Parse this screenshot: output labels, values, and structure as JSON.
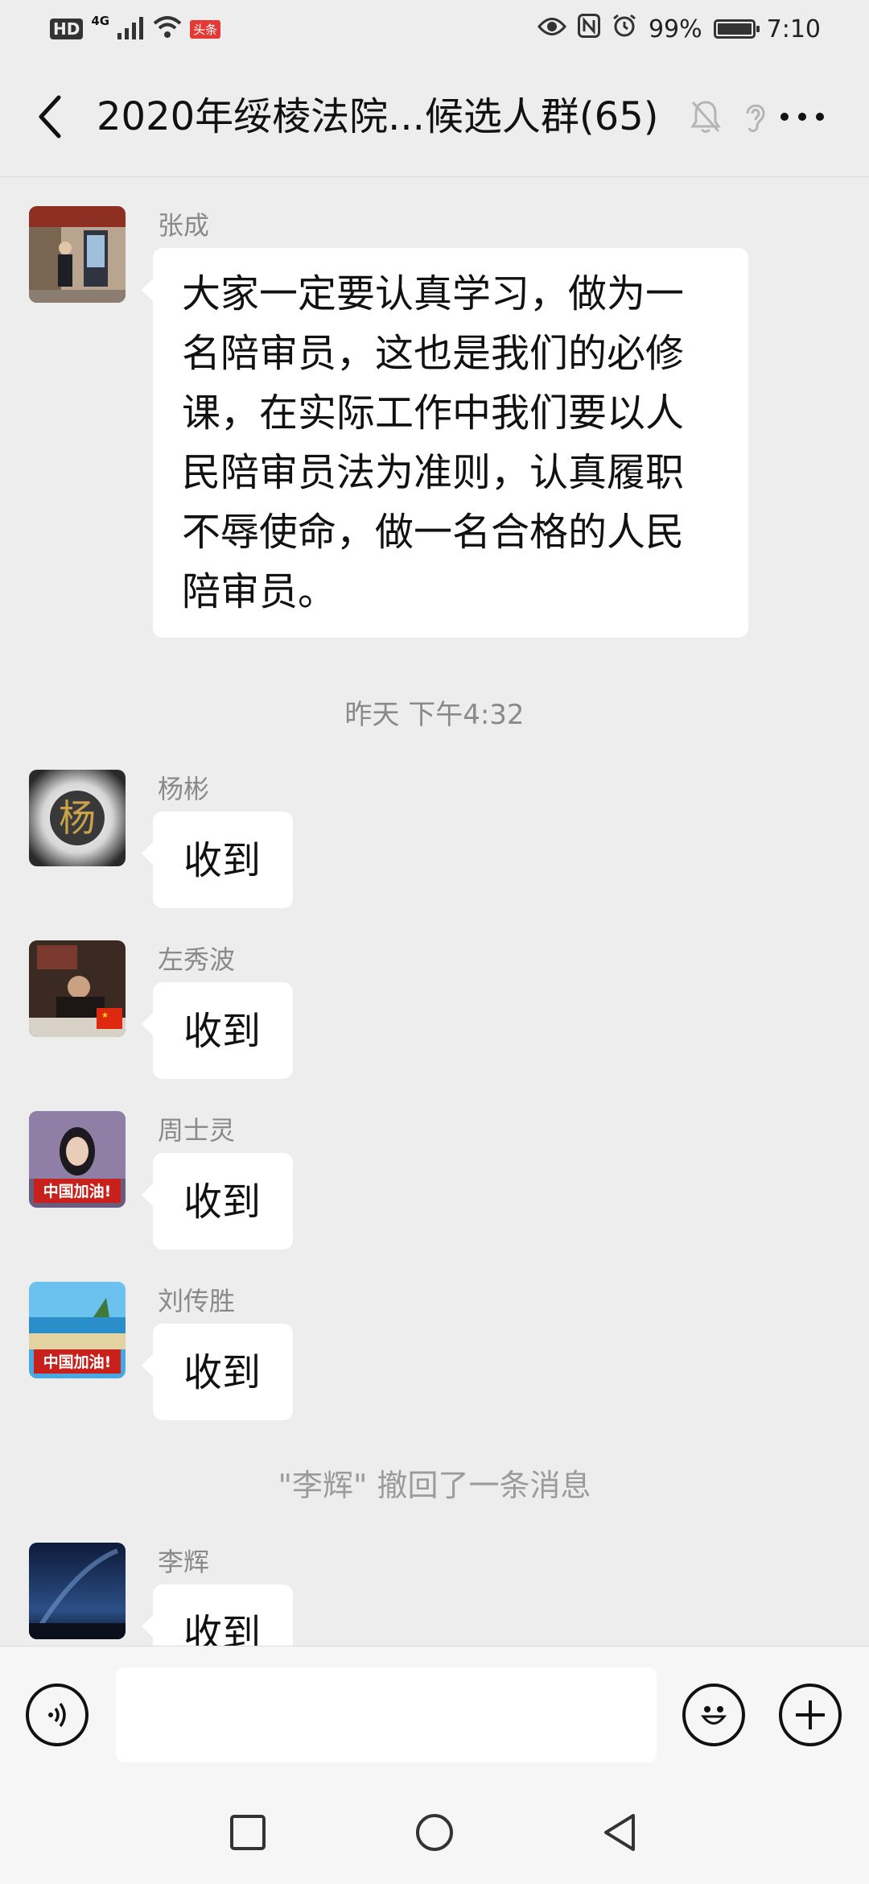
{
  "status_bar": {
    "hd": "HD",
    "network": "4G",
    "app_badge": "头条",
    "battery": "99%",
    "battery_level": 0.99,
    "time": "7:10"
  },
  "header": {
    "title": "2020年绥棱法院...候选人群(65)"
  },
  "messages": [
    {
      "sender": "张成",
      "text": "大家一定要认真学习，做为一名陪审员，这也是我们的必修课，在实际工作中我们要以人民陪审员法为准则，认真履职不辱使命，做一名合格的人民陪审员。",
      "lines": [
        "大家一定要认真学习，做为一",
        "名陪审员，这也是我们的必修",
        "课，在实际工作中我们要以人",
        "民陪审员法为准则，认真履职",
        "不辱使命，做一名合格的人民",
        "陪审员。"
      ]
    },
    {
      "sender": "杨彬",
      "text": "收到",
      "avatar_char": "杨"
    },
    {
      "sender": "左秀波",
      "text": "收到"
    },
    {
      "sender": "周士灵",
      "text": "收到",
      "avatar_banner": "中国加油!"
    },
    {
      "sender": "刘传胜",
      "text": "收到",
      "avatar_banner": "中国加油!"
    },
    {
      "sender": "李辉",
      "text": "收到"
    }
  ],
  "timestamp": "昨天 下午4:32",
  "recall_notice": "\"李辉\" 撤回了一条消息",
  "input": {
    "value": "",
    "placeholder": ""
  },
  "icons": {
    "back": "chevron-left-icon",
    "mute": "bell-off-icon",
    "ear": "ear-icon",
    "more": "more-dots-icon",
    "voice": "voice-icon",
    "emoji": "emoji-icon",
    "plus": "plus-icon"
  },
  "colors": {
    "background": "#ededed",
    "bubble": "#ffffff",
    "meta_text": "#8a8a8a"
  }
}
